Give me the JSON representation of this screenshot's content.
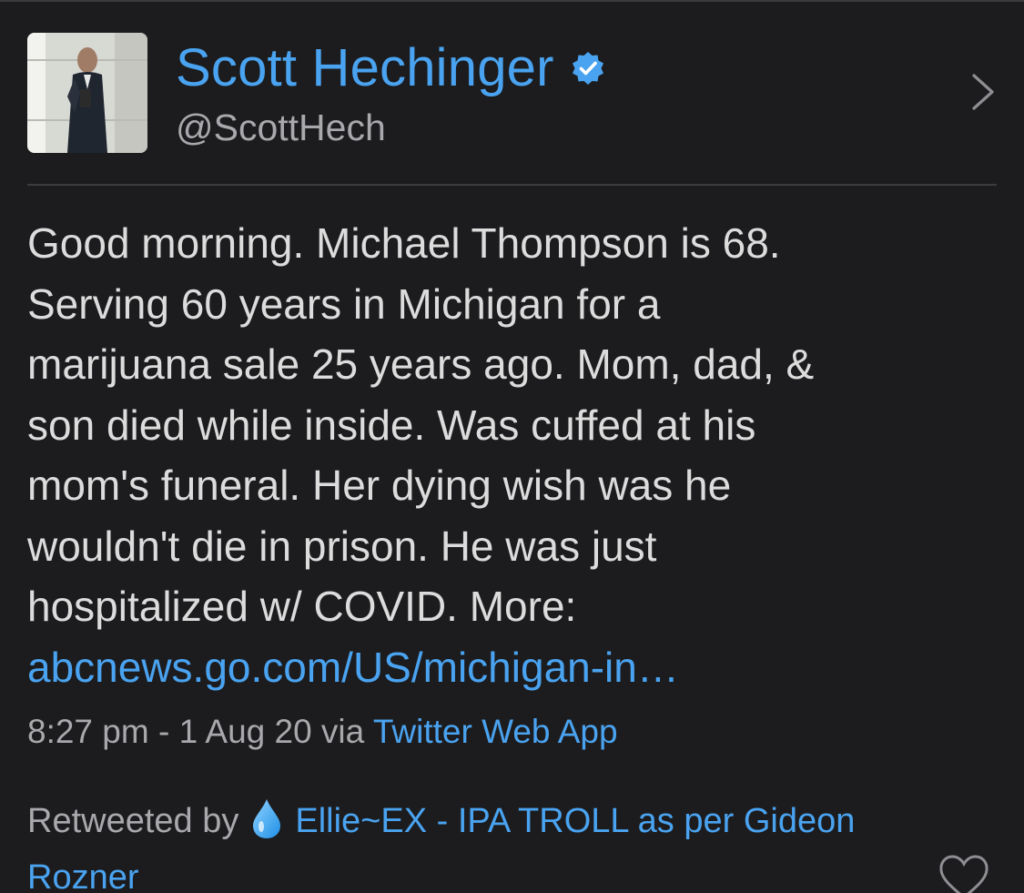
{
  "author": {
    "name": "Scott Hechinger",
    "handle": "@ScottHech",
    "verified_icon": "verified-badge-icon",
    "avatar": "profile-photo"
  },
  "tweet": {
    "lines": [
      "Good morning. Michael Thompson is 68.",
      "Serving 60 years in Michigan for a",
      "marijuana sale 25 years ago. Mom, dad, &",
      "son died while inside. Was cuffed at his",
      "mom's funeral. Her dying wish was he",
      "wouldn't die in prison. He was just",
      "hospitalized w/ COVID. More:"
    ],
    "link": "abcnews.go.com/US/michigan-in…"
  },
  "meta": {
    "timestamp": "8:27 pm - 1 Aug 20 via ",
    "source": "Twitter Web App"
  },
  "retweet": {
    "label": "Retweeted by",
    "emoji_icon": "droplet-icon",
    "name_line1": "Ellie~EX - IPA TROLL as per Gideon",
    "name_line2": "Rozner"
  },
  "icons": {
    "chevron": "chevron-right-icon",
    "like": "heart-icon"
  },
  "colors": {
    "background": "#1c1c1e",
    "accent": "#4aa3f0",
    "text": "#dcdcdc",
    "secondary": "#a9a9ad"
  }
}
